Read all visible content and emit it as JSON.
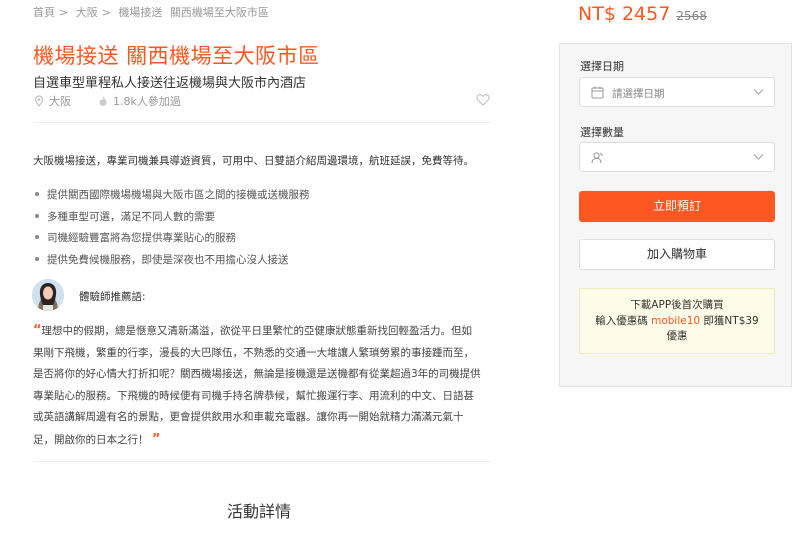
{
  "breadcrumb": {
    "items": [
      "首頁",
      "大阪",
      "機場接送",
      "關西機場至大阪市區"
    ],
    "separator": ">"
  },
  "product": {
    "title": "機場接送 關西機場至大阪市區",
    "subtitle": "自選車型單程私人接送往返機場與大阪市內酒店",
    "location": "大阪",
    "participants": "1.8k人參加過",
    "intro": "大阪機場接送，專業司機兼具導遊資質，可用中、日雙語介紹周邊環境，航班延誤，免費等待。",
    "bullets": [
      "提供關西國際機場機場與大阪市區之間的接機或送機服務",
      "多種車型可選，滿足不同人數的需要",
      "司機經驗豐富將為您提供專業貼心的服務",
      "提供免費候機服務，即使是深夜也不用擔心沒人接送"
    ],
    "expert_label": "體驗師推薦語:",
    "quote_lines": [
      "理想中的假期，總是愜意又清新滿溢，欲從平日里繁忙的亞健康狀態重新找回輕盈活力。但如",
      "果剛下飛機，繁重的行李，漫長的大巴隊伍，不熟悉的交通一大堆讓人繁瑣勞累的事接踵而至，",
      "是否將你的好心情大打折扣呢？關西機場接送，無論是接機還是送機都有從業超過3年的司機提供",
      "專業貼心的服務。下飛機的時候便有司機手持名牌恭候，幫忙搬運行李、用流利的中文、日語甚",
      "或英語講解周邊有名的景點，更會提供飲用水和車載充電器。讓你再一開始就精力滿滿元氣十",
      "足，開啟你的日本之行！"
    ],
    "quote_open": "“",
    "quote_close": "”",
    "section_title": "活動詳情"
  },
  "booking": {
    "price": "NT$ 2457",
    "original_price": "2568",
    "date_label": "選擇日期",
    "date_placeholder": "請選擇日期",
    "qty_label": "選擇數量",
    "book_button": "立即預訂",
    "cart_button": "加入購物車",
    "promo_line1": "下載APP後首次購買",
    "promo_line2_prefix": "輸入優惠碼",
    "promo_code": "mobile10",
    "promo_line2_suffix": "即獲NT$39",
    "promo_line3": "優惠"
  },
  "colors": {
    "accent": "#ff5722",
    "panel_bg": "#f6f6f6",
    "promo_bg": "#fefce8"
  },
  "icons": [
    "location-pin-icon",
    "fire-icon",
    "heart-icon",
    "calendar-icon",
    "people-icon",
    "chevron-down-icon"
  ]
}
